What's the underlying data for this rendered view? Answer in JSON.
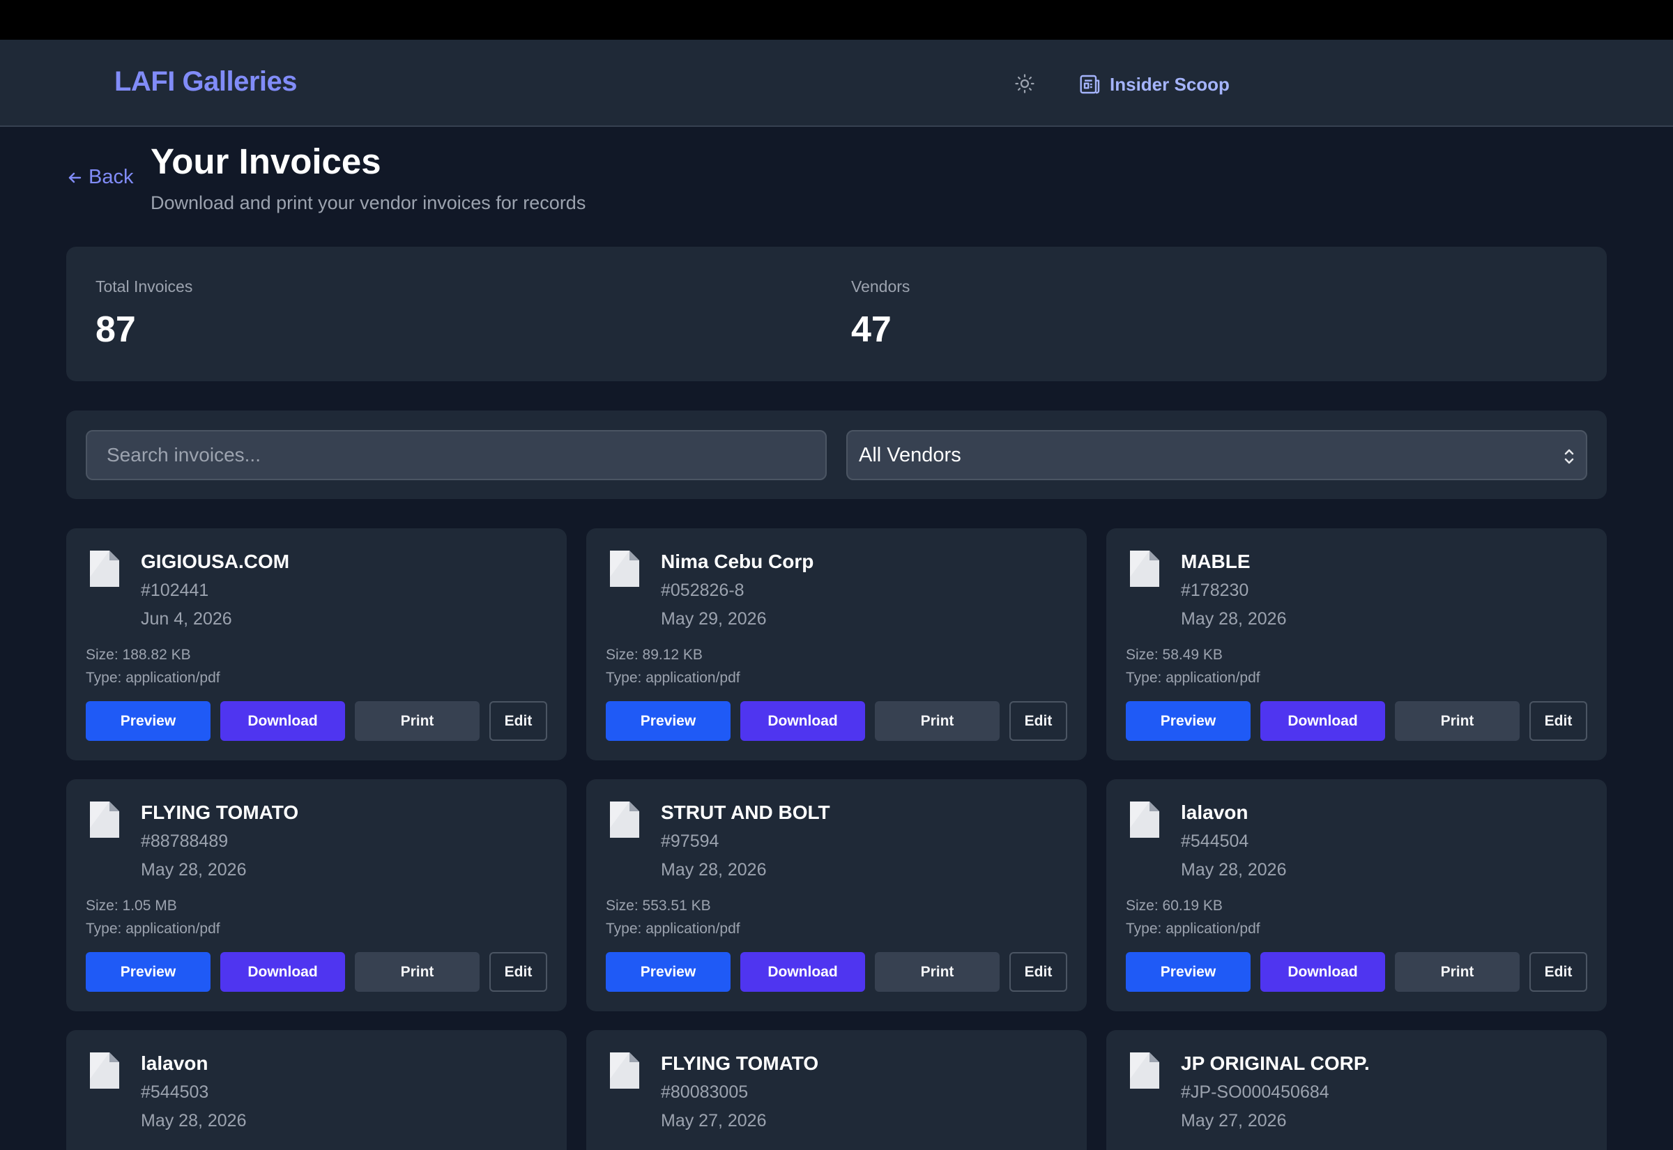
{
  "header": {
    "brand": "LAFI Galleries",
    "theme_icon": "sun-icon",
    "scoop_icon": "newspaper-icon",
    "scoop_label": "Insider Scoop"
  },
  "nav": {
    "back_label": "Back",
    "back_icon": "arrow-left-icon"
  },
  "page": {
    "title": "Your Invoices",
    "subtitle": "Download and print your vendor invoices for records"
  },
  "stats": [
    {
      "label": "Total Invoices",
      "value": "87"
    },
    {
      "label": "Vendors",
      "value": "47"
    }
  ],
  "filters": {
    "search_placeholder": "Search invoices...",
    "search_value": "",
    "vendor_selected": "All Vendors"
  },
  "actions": {
    "preview": "Preview",
    "download": "Download",
    "print": "Print",
    "edit": "Edit"
  },
  "invoices": [
    {
      "vendor": "GIGIOUSA.COM",
      "number": "#102441",
      "date": "Jun 4, 2026",
      "size": "Size: 188.82 KB",
      "type": "Type: application/pdf"
    },
    {
      "vendor": "Nima Cebu Corp",
      "number": "#052826-8",
      "date": "May 29, 2026",
      "size": "Size: 89.12 KB",
      "type": "Type: application/pdf"
    },
    {
      "vendor": "MABLE",
      "number": "#178230",
      "date": "May 28, 2026",
      "size": "Size: 58.49 KB",
      "type": "Type: application/pdf"
    },
    {
      "vendor": "FLYING TOMATO",
      "number": "#88788489",
      "date": "May 28, 2026",
      "size": "Size: 1.05 MB",
      "type": "Type: application/pdf"
    },
    {
      "vendor": "STRUT AND BOLT",
      "number": "#97594",
      "date": "May 28, 2026",
      "size": "Size: 553.51 KB",
      "type": "Type: application/pdf"
    },
    {
      "vendor": "lalavon",
      "number": "#544504",
      "date": "May 28, 2026",
      "size": "Size: 60.19 KB",
      "type": "Type: application/pdf"
    },
    {
      "vendor": "lalavon",
      "number": "#544503",
      "date": "May 28, 2026"
    },
    {
      "vendor": "FLYING TOMATO",
      "number": "#80083005",
      "date": "May 27, 2026"
    },
    {
      "vendor": "JP ORIGINAL CORP.",
      "number": "#JP-SO000450684",
      "date": "May 27, 2026"
    }
  ],
  "colors": {
    "background": "#111827",
    "panel": "#1f2937",
    "accent": "#818cf8",
    "preview_button": "#1f5af6",
    "download_button": "#4f35f0"
  }
}
